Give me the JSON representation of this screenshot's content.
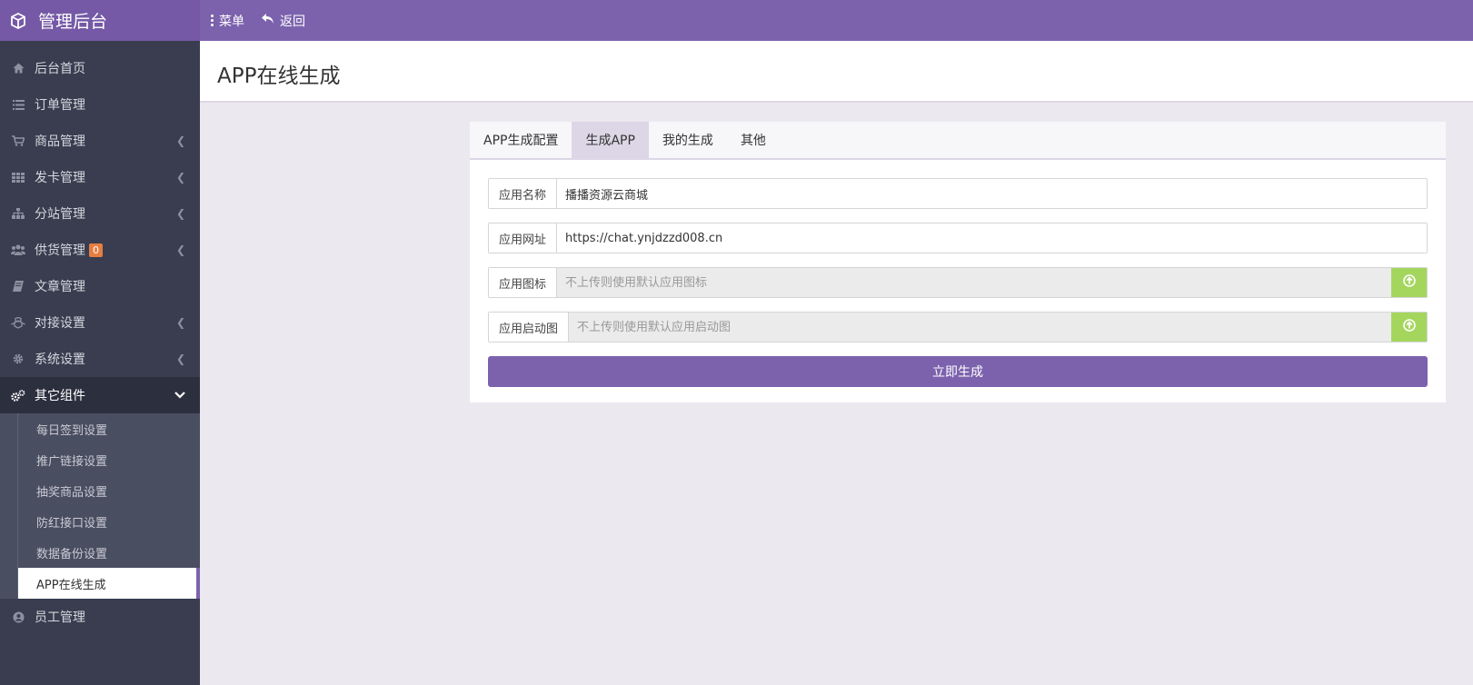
{
  "header": {
    "title": "管理后台",
    "menu_label": "菜单",
    "back_label": "返回"
  },
  "sidebar": {
    "items": [
      {
        "label": "后台首页",
        "icon": "home-icon"
      },
      {
        "label": "订单管理",
        "icon": "list-icon"
      },
      {
        "label": "商品管理",
        "icon": "cart-icon"
      },
      {
        "label": "发卡管理",
        "icon": "grid-icon"
      },
      {
        "label": "分站管理",
        "icon": "sitemap-icon"
      },
      {
        "label": "供货管理",
        "icon": "users-icon",
        "badge": "0"
      },
      {
        "label": "文章管理",
        "icon": "book-icon"
      },
      {
        "label": "对接设置",
        "icon": "cubes-icon"
      },
      {
        "label": "系统设置",
        "icon": "gear-icon"
      },
      {
        "label": "其它组件",
        "icon": "gears-icon"
      }
    ],
    "subitems": [
      "每日签到设置",
      "推广链接设置",
      "抽奖商品设置",
      "防红接口设置",
      "数据备份设置",
      "APP在线生成"
    ],
    "last_item": {
      "label": "员工管理",
      "icon": "user-circle-icon"
    }
  },
  "page": {
    "title": "APP在线生成"
  },
  "tabs": [
    "APP生成配置",
    "生成APP",
    "我的生成",
    "其他"
  ],
  "form": {
    "app_name_label": "应用名称",
    "app_name_value": "播播资源云商城",
    "app_url_label": "应用网址",
    "app_url_value": "https://chat.ynjdzzd008.cn",
    "app_icon_label": "应用图标",
    "app_icon_placeholder": "不上传则使用默认应用图标",
    "app_splash_label": "应用启动图",
    "app_splash_placeholder": "不上传则使用默认应用启动图",
    "submit_label": "立即生成"
  },
  "colors": {
    "accent": "#7c62ad",
    "sidebar": "#393d4f",
    "upload": "#a4d65e",
    "badge": "#e67e41"
  }
}
